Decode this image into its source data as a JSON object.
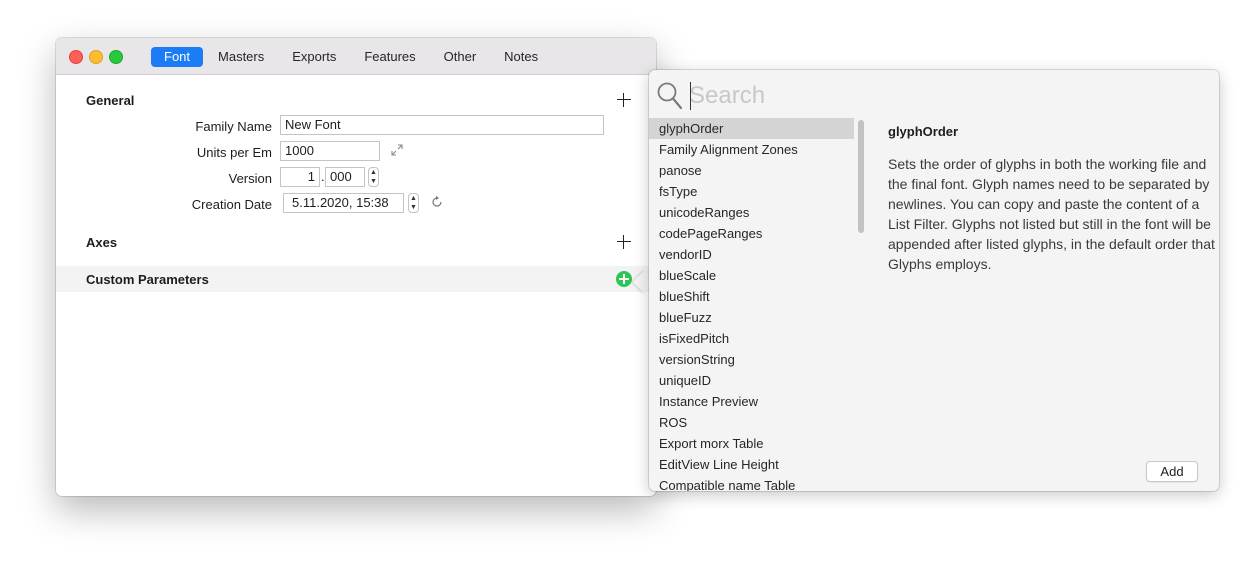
{
  "tabs": [
    "Font",
    "Masters",
    "Exports",
    "Features",
    "Other",
    "Notes"
  ],
  "active_tab": "Font",
  "general": {
    "title": "General",
    "family_name_label": "Family Name",
    "family_name_value": "New Font",
    "units_label": "Units per Em",
    "units_value": "1000",
    "version_label": "Version",
    "version_major": "1",
    "version_sep": ".",
    "version_minor": "000",
    "creation_label": "Creation Date",
    "creation_value": "5.11.2020, 15:38"
  },
  "axes": {
    "title": "Axes"
  },
  "custom_parameters": {
    "title": "Custom Parameters"
  },
  "popover": {
    "search_placeholder": "Search",
    "items": [
      "glyphOrder",
      "Family Alignment Zones",
      "panose",
      "fsType",
      "unicodeRanges",
      "codePageRanges",
      "vendorID",
      "blueScale",
      "blueShift",
      "blueFuzz",
      "isFixedPitch",
      "versionString",
      "uniqueID",
      "Instance Preview",
      "ROS",
      "Export morx Table",
      "EditView Line Height",
      "Compatible name Table"
    ],
    "selected": "glyphOrder",
    "description_title": "glyphOrder",
    "description": "Sets the order of glyphs in both the working file and the final font. Glyph names need to be separated by newlines. You can copy and paste the content of a List Filter. Glyphs not listed but still in the font will be appended after listed glyphs, in the default order that Glyphs employs.",
    "add_label": "Add"
  },
  "colors": {
    "accent": "#1b7cf5",
    "add_parameter": "#2bc653",
    "close": "#fe5f57",
    "minimize": "#febc2e",
    "zoom": "#28c840"
  }
}
